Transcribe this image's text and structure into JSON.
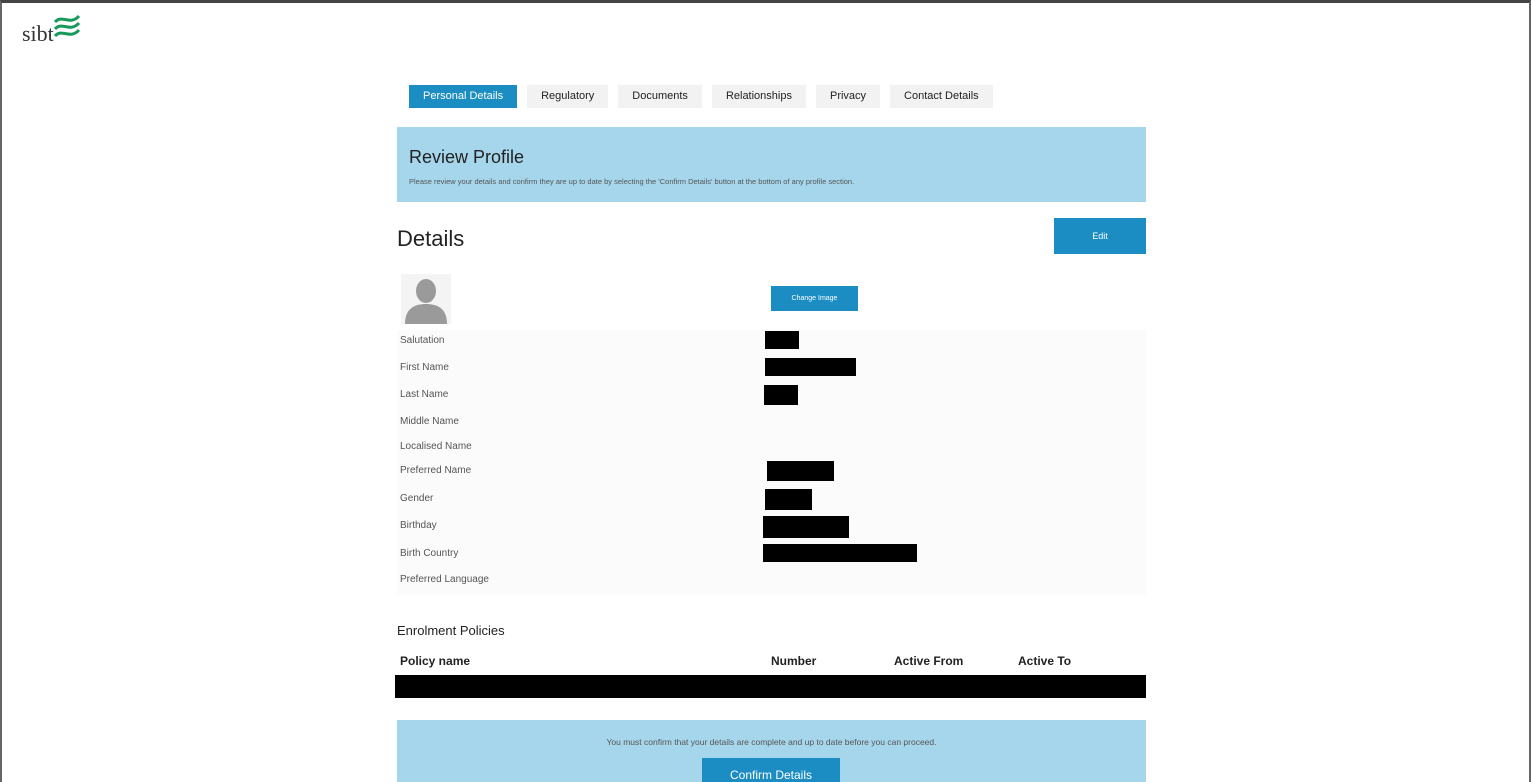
{
  "brand": {
    "logo_text": "sibt",
    "logo_color": "#1a9a5a"
  },
  "tabs": [
    {
      "label": "Personal Details",
      "active": true
    },
    {
      "label": "Regulatory",
      "active": false
    },
    {
      "label": "Documents",
      "active": false
    },
    {
      "label": "Relationships",
      "active": false
    },
    {
      "label": "Privacy",
      "active": false
    },
    {
      "label": "Contact Details",
      "active": false
    }
  ],
  "review": {
    "title": "Review Profile",
    "message": "Please review your details and confirm they are up to date by selecting the 'Confirm Details' button at the bottom of any profile section."
  },
  "details": {
    "title": "Details",
    "edit_label": "Edit",
    "change_image_label": "Change Image",
    "fields": [
      {
        "label": "Salutation",
        "redacted": true
      },
      {
        "label": "First Name",
        "redacted": true
      },
      {
        "label": "Last Name",
        "redacted": true
      },
      {
        "label": "Middle Name",
        "redacted": false
      },
      {
        "label": "Localised Name",
        "redacted": false
      },
      {
        "label": "Preferred Name",
        "redacted": true
      },
      {
        "label": "Gender",
        "redacted": true
      },
      {
        "label": "Birthday",
        "redacted": true
      },
      {
        "label": "Birth Country",
        "redacted": true
      },
      {
        "label": "Preferred Language",
        "redacted": false
      }
    ]
  },
  "policies": {
    "title": "Enrolment Policies",
    "columns": [
      "Policy name",
      "Number",
      "Active From",
      "Active To"
    ],
    "rows_redacted": 1
  },
  "confirm": {
    "message": "You must confirm that your details are complete and up to date before you can proceed.",
    "button_label": "Confirm Details"
  },
  "colors": {
    "accent": "#1b8dc2",
    "panel": "#a6d6ec",
    "redaction": "#000000"
  }
}
